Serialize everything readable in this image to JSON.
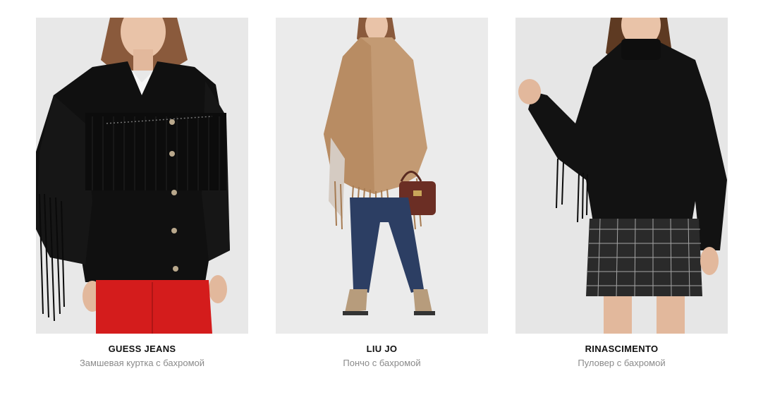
{
  "products": [
    {
      "brand": "GUESS JEANS",
      "title": "Замшевая куртка с бахромой",
      "image": "model-black-suede-fringe-jacket"
    },
    {
      "brand": "LIU JO",
      "title": "Пончо с бахромой",
      "image": "model-camel-fringe-poncho"
    },
    {
      "brand": "RINASCIMENTO",
      "title": "Пуловер с бахромой",
      "image": "model-black-fringe-sweater"
    }
  ],
  "colors": {
    "background": "#ffffff",
    "photo_bg": "#e9e9e9",
    "brand_text": "#111111",
    "title_text": "#8a8a8a"
  }
}
